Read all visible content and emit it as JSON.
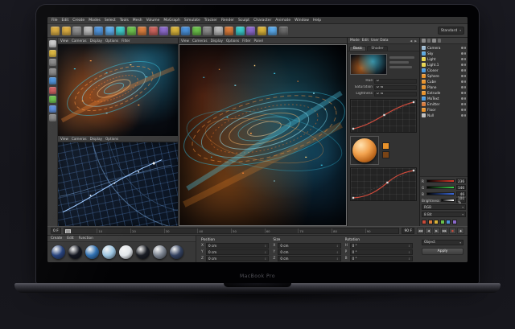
{
  "device": {
    "brand_label": "MacBook Pro"
  },
  "colors": {
    "background": "#15151b",
    "bezel": "#020204",
    "ui_panel": "#383838",
    "accent_orange": "#e8922a",
    "viewport_cyan": "#38c8e8",
    "curve_red": "#cf4b3c",
    "brand_text": "#55555c"
  },
  "menu": {
    "items": [
      "File",
      "Edit",
      "Create",
      "Modes",
      "Select",
      "Tools",
      "Mesh",
      "Volume",
      "MoGraph",
      "Simulate",
      "Tracker",
      "Render",
      "Sculpt",
      "Character",
      "Animate",
      "Window",
      "Help"
    ]
  },
  "toolbar": {
    "layout_label": "Standard",
    "icons": [
      {
        "name": "undo-icon",
        "color": "#d8a83a"
      },
      {
        "name": "redo-icon",
        "color": "#d8a83a"
      },
      {
        "name": "live-select-icon",
        "color": "#8a8a8a"
      },
      {
        "name": "move-tool-icon",
        "color": "#b8b8b8"
      },
      {
        "name": "scale-tool-icon",
        "color": "#4a90d9"
      },
      {
        "name": "rotate-tool-icon",
        "color": "#5aa8e8"
      },
      {
        "name": "coord-system-icon",
        "color": "#3ac8c8"
      },
      {
        "name": "render-view-icon",
        "color": "#6abf4a"
      },
      {
        "name": "render-settings-icon",
        "color": "#d87a3a"
      },
      {
        "name": "cube-primitive-icon",
        "color": "#c9605a"
      },
      {
        "name": "pen-spline-icon",
        "color": "#8a68c9"
      },
      {
        "name": "mograph-icon",
        "color": "#d8b23a"
      },
      {
        "name": "volume-icon",
        "color": "#4a90d9"
      },
      {
        "name": "simulate-icon",
        "color": "#6abf4a"
      },
      {
        "name": "camera-icon",
        "color": "#8a8a8a"
      },
      {
        "name": "light-icon",
        "color": "#b8b8b8"
      },
      {
        "name": "material-icon",
        "color": "#d87a3a"
      },
      {
        "name": "environment-icon",
        "color": "#3ac8c8"
      },
      {
        "name": "deformer-icon",
        "color": "#8a68c9"
      },
      {
        "name": "field-icon",
        "color": "#d8b23a"
      },
      {
        "name": "tag-icon",
        "color": "#5aa8e8"
      },
      {
        "name": "snap-icon",
        "color": "#6a6a6a"
      }
    ]
  },
  "left_toolbar": {
    "icons": [
      {
        "name": "live-select-icon",
        "color": "#c8c8c8"
      },
      {
        "name": "move-icon",
        "color": "#d8b23a"
      },
      {
        "name": "scale-icon",
        "color": "#888888"
      },
      {
        "name": "rotate-icon",
        "color": "#888888"
      },
      {
        "name": "last-tool-icon",
        "color": "#4a90d9"
      },
      {
        "name": "x-axis-lock-icon",
        "color": "#c85a5a"
      },
      {
        "name": "y-axis-lock-icon",
        "color": "#6abf4a"
      },
      {
        "name": "z-axis-lock-icon",
        "color": "#5a8ad8"
      },
      {
        "name": "workplane-icon",
        "color": "#888888"
      }
    ]
  },
  "viewports": {
    "left": {
      "header_items": [
        "View",
        "Cameras",
        "Display",
        "Options",
        "Filter"
      ]
    },
    "bottom_left": {
      "header_items": [
        "View",
        "Cameras",
        "Display",
        "Options"
      ]
    },
    "center": {
      "header_items": [
        "View",
        "Cameras",
        "Display",
        "Options",
        "Filter",
        "Panel"
      ]
    }
  },
  "attribute_panel": {
    "header_items": [
      "Mode",
      "Edit",
      "User Data"
    ],
    "nav_prev": "◀",
    "nav_next": "▶",
    "tabs": [
      "Basic",
      "Shader"
    ],
    "fields": [
      {
        "label": "Hue",
        "value": "0 °"
      },
      {
        "label": "Saturation",
        "value": "0 %"
      },
      {
        "label": "Lightness",
        "value": "0 %"
      }
    ]
  },
  "object_panel": {
    "items": [
      {
        "name": "Camera",
        "color": "#9ab8d0"
      },
      {
        "name": "Sky",
        "color": "#5aa8e0"
      },
      {
        "name": "Light",
        "color": "#e8d44a"
      },
      {
        "name": "Light.1",
        "color": "#e8d44a"
      },
      {
        "name": "Cloner",
        "color": "#4a9ae0"
      },
      {
        "name": "Sphere",
        "color": "#e8922a"
      },
      {
        "name": "Cube",
        "color": "#e8922a"
      },
      {
        "name": "Plane",
        "color": "#e8922a"
      },
      {
        "name": "Extrude",
        "color": "#e8922a"
      },
      {
        "name": "MoText",
        "color": "#4a9ae0"
      },
      {
        "name": "Emitter",
        "color": "#d87a3a"
      },
      {
        "name": "Floor",
        "color": "#e8922a"
      },
      {
        "name": "Null",
        "color": "#c0c0c0"
      }
    ]
  },
  "color_panel": {
    "channels": [
      {
        "label": "R",
        "value": "236",
        "color": "#e03a2a"
      },
      {
        "label": "G",
        "value": "146",
        "color": "#3ad04a"
      },
      {
        "label": "B",
        "value": "46",
        "color": "#3a6ae0"
      }
    ],
    "brightness_label": "Brightness",
    "brightness_value": "100 %",
    "dropdowns": [
      {
        "value": "RGB"
      },
      {
        "value": "8 Bit"
      }
    ],
    "swatches": [
      {
        "color": "#c84a3a"
      },
      {
        "color": "#d87a3a"
      },
      {
        "color": "#d8b23a"
      },
      {
        "color": "#6abf4a"
      },
      {
        "color": "#4a90d9"
      },
      {
        "color": "#8a68c9"
      }
    ]
  },
  "timeline": {
    "current_frame": "0 F",
    "end_frame": "90 F",
    "ticks": [
      "0",
      "10",
      "20",
      "30",
      "40",
      "50",
      "60",
      "70",
      "80",
      "90"
    ],
    "transport": [
      {
        "glyph": "◀◀",
        "color": "#cccccc"
      },
      {
        "glyph": "◀",
        "color": "#cccccc"
      },
      {
        "glyph": "▶",
        "color": "#cccccc"
      },
      {
        "glyph": "▶▶",
        "color": "#cccccc"
      },
      {
        "glyph": "●",
        "color": "#c84a3a"
      },
      {
        "glyph": "◆",
        "color": "#cccccc"
      }
    ]
  },
  "materials": {
    "menu": [
      "Create",
      "Edit",
      "Function"
    ],
    "swatches": [
      {
        "color": "#24407a"
      },
      {
        "color": "#10131c"
      },
      {
        "color": "#2e6fb0"
      },
      {
        "color": "#9cc4e0"
      },
      {
        "color": "#e2e6ea"
      },
      {
        "color": "#1a1d24"
      },
      {
        "color": "#7a828e"
      },
      {
        "color": "#32405e"
      }
    ]
  },
  "coordinates": {
    "columns": [
      {
        "title": "Position",
        "rows": [
          {
            "axis": "X",
            "value": "0 cm"
          },
          {
            "axis": "Y",
            "value": "0 cm"
          },
          {
            "axis": "Z",
            "value": "0 cm"
          }
        ]
      },
      {
        "title": "Size",
        "rows": [
          {
            "axis": "X",
            "value": "0 cm"
          },
          {
            "axis": "Y",
            "value": "0 cm"
          },
          {
            "axis": "Z",
            "value": "0 cm"
          }
        ]
      },
      {
        "title": "Rotation",
        "rows": [
          {
            "axis": "H",
            "value": "0 °"
          },
          {
            "axis": "P",
            "value": "0 °"
          },
          {
            "axis": "B",
            "value": "0 °"
          }
        ]
      }
    ],
    "object_label": "Object",
    "apply_label": "Apply"
  }
}
